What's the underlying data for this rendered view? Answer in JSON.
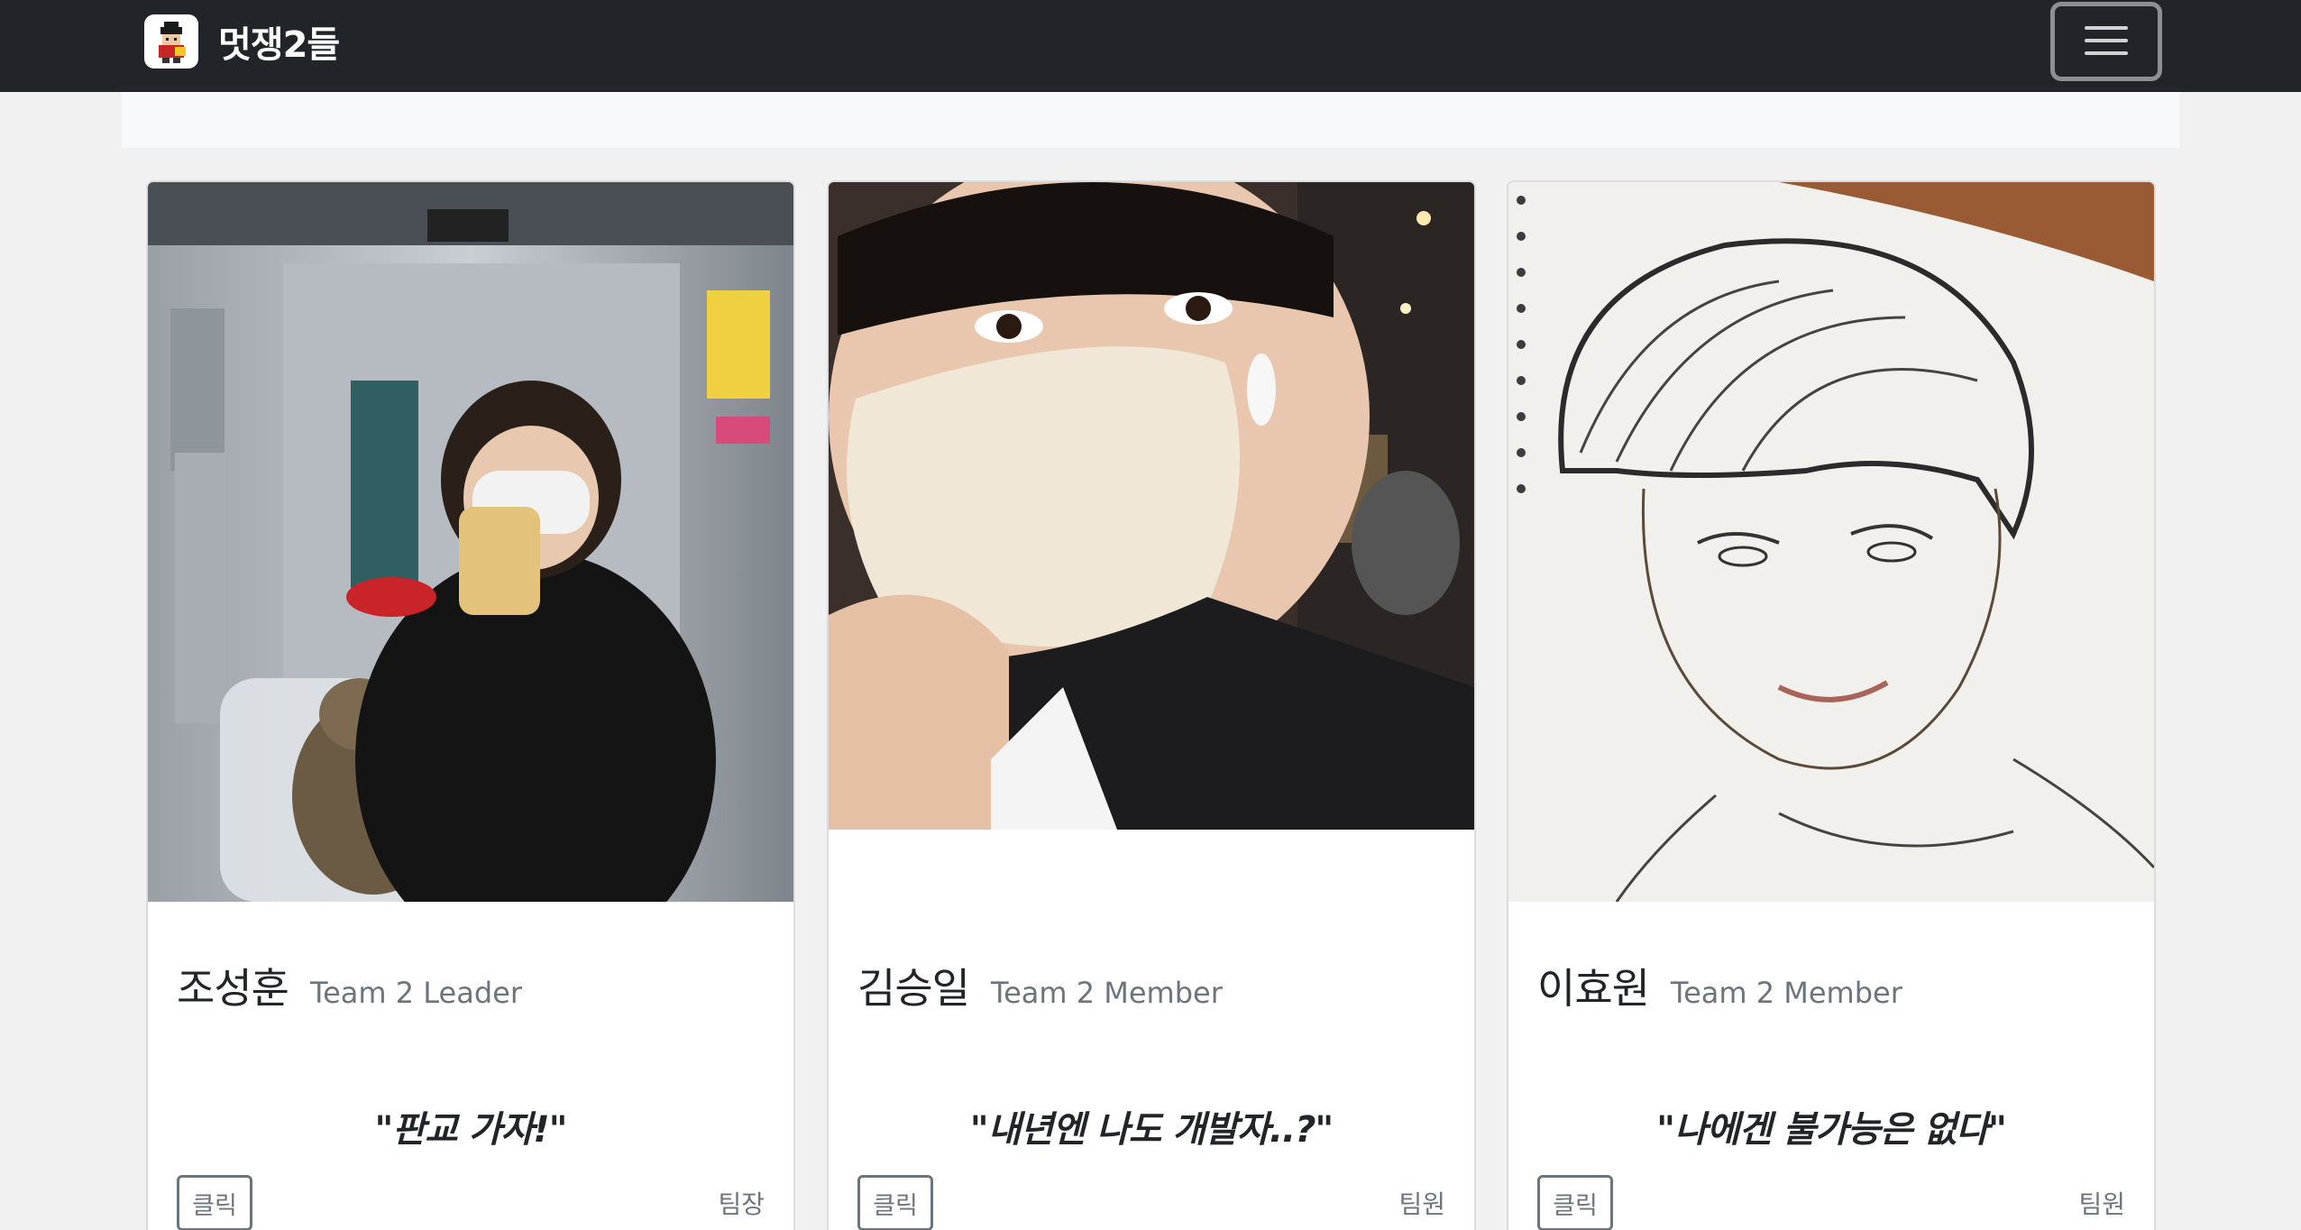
{
  "navbar": {
    "brand_name": "멋쟁2들",
    "logo_icon": "pixel-character-logo",
    "menu_icon": "hamburger-menu-icon"
  },
  "colors": {
    "navbar_bg": "#212529",
    "page_bg": "#f1f1f1",
    "muted_text": "#6c757d"
  },
  "cards": [
    {
      "image": "member photo: person in elevator holding phone, cat in carrier",
      "name": "조성훈",
      "role": "Team 2 Leader",
      "quote": "\"판교 가자!\"",
      "button_label": "클릭",
      "tag": "팀장"
    },
    {
      "image": "member photo: selfie with white face mask and earbud",
      "name": "김승일",
      "role": "Team 2 Member",
      "quote": "\"내년엔 나도 개발자..?\"",
      "button_label": "클릭",
      "tag": "팀원"
    },
    {
      "image": "member photo: pencil sketch portrait on sketchbook",
      "name": "이효원",
      "role": "Team 2 Member",
      "quote": "\"나에겐 불가능은 없다\"",
      "button_label": "클릭",
      "tag": "팀원"
    }
  ]
}
